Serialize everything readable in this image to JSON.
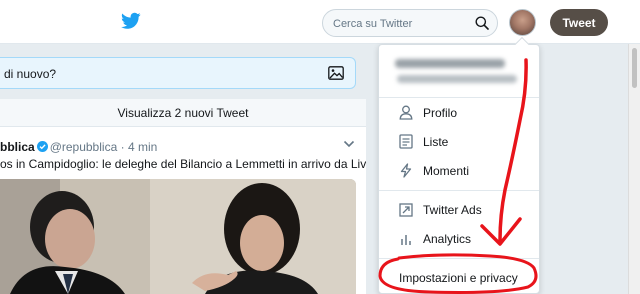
{
  "header": {
    "logo_icon": "twitter-bird-icon",
    "search": {
      "placeholder": "Cerca su Twitter",
      "value": "",
      "icon": "search-icon"
    },
    "tweet_button_label": "Tweet",
    "brand_color": "#1da1f2",
    "tweet_button_color": "#564e47"
  },
  "compose": {
    "placeholder": "di nuovo?",
    "image_icon": "image-icon"
  },
  "timeline": {
    "new_tweets_label": "Visualizza 2 nuovi Tweet",
    "tweet": {
      "author_name": "bblica",
      "handle": "@repubblica",
      "separator": "·",
      "time": "4 min",
      "text": "os in Campidoglio: le deleghe del Bilancio a Lemmetti in arrivo da Livorno"
    }
  },
  "menu": {
    "items": [
      {
        "label": "Profilo",
        "icon": "user-icon"
      },
      {
        "label": "Liste",
        "icon": "list-icon"
      },
      {
        "label": "Momenti",
        "icon": "lightning-icon"
      },
      {
        "label": "Twitter Ads",
        "icon": "external-link-icon"
      },
      {
        "label": "Analytics",
        "icon": "bar-chart-icon"
      },
      {
        "label": "Impostazioni e privacy"
      }
    ]
  },
  "annotation": {
    "color": "#e8141b"
  }
}
